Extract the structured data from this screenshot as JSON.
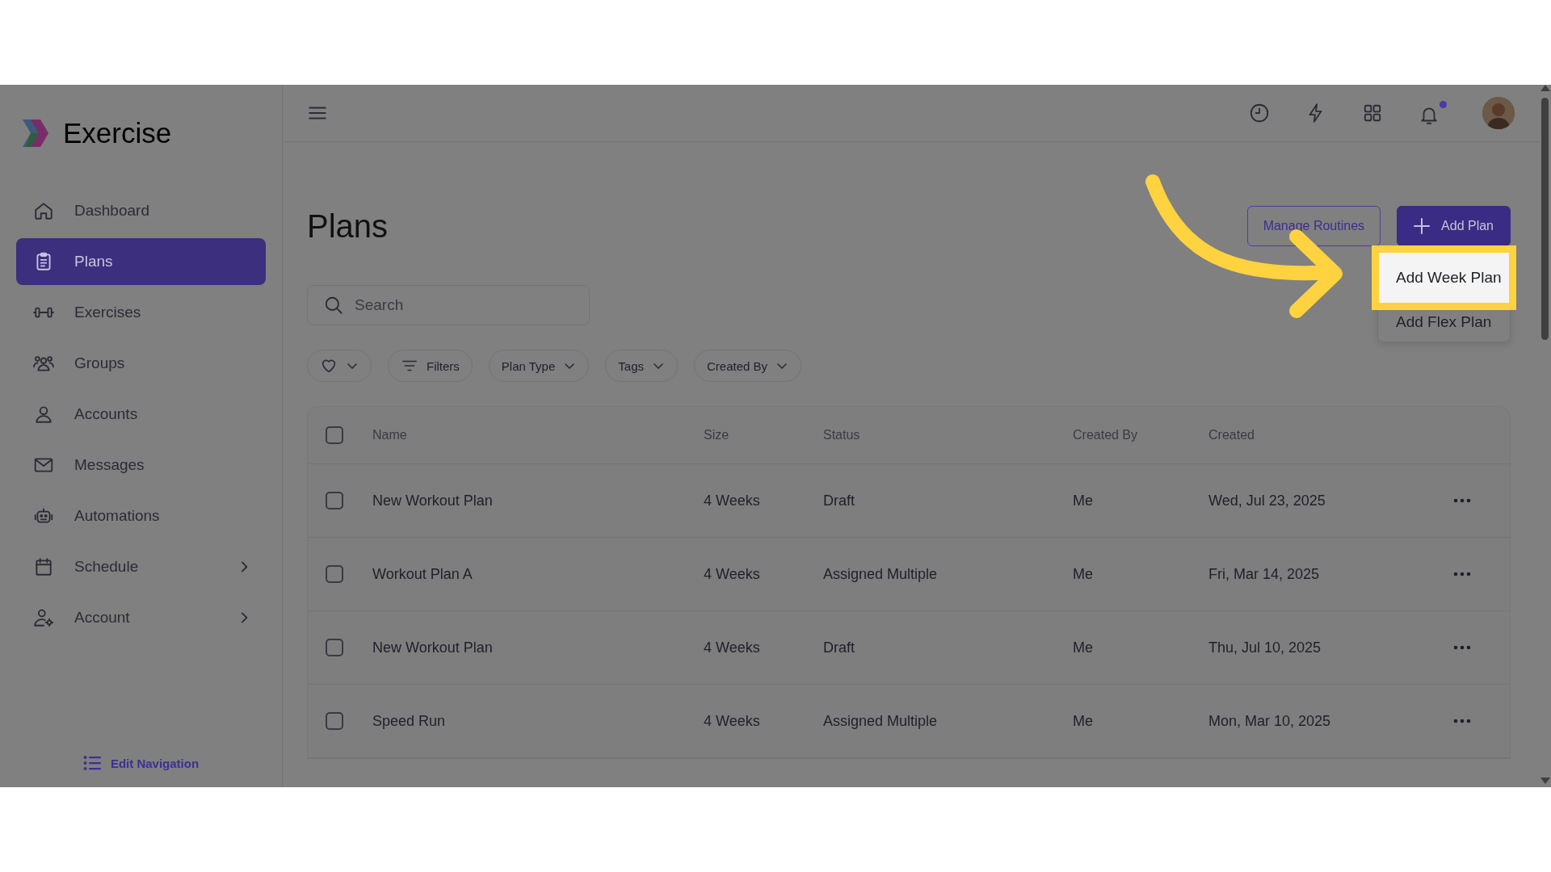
{
  "app": {
    "name": "Exercise"
  },
  "sidebar": {
    "items": [
      {
        "label": "Dashboard",
        "selected": false,
        "has_submenu": false
      },
      {
        "label": "Plans",
        "selected": true,
        "has_submenu": false
      },
      {
        "label": "Exercises",
        "selected": false,
        "has_submenu": false
      },
      {
        "label": "Groups",
        "selected": false,
        "has_submenu": false
      },
      {
        "label": "Accounts",
        "selected": false,
        "has_submenu": false
      },
      {
        "label": "Messages",
        "selected": false,
        "has_submenu": false
      },
      {
        "label": "Automations",
        "selected": false,
        "has_submenu": false
      },
      {
        "label": "Schedule",
        "selected": false,
        "has_submenu": true
      },
      {
        "label": "Account",
        "selected": false,
        "has_submenu": true
      }
    ],
    "edit_navigation": "Edit Navigation"
  },
  "page": {
    "title": "Plans",
    "buttons": [
      {
        "kind": "outline",
        "label": "Manage Routines"
      },
      {
        "kind": "primary",
        "label": "Add Plan"
      }
    ],
    "add_menu": [
      {
        "label": "Add Week Plan",
        "highlighted": true
      },
      {
        "label": "Add Flex Plan",
        "highlighted": false
      }
    ],
    "search": {
      "placeholder": "Search"
    },
    "filters": [
      {
        "kind": "favorite"
      },
      {
        "kind": "filter",
        "label": "Filters"
      },
      {
        "kind": "dropdown",
        "label": "Plan Type"
      },
      {
        "kind": "dropdown",
        "label": "Tags"
      },
      {
        "kind": "dropdown",
        "label": "Created By"
      }
    ]
  },
  "table": {
    "columns": [
      "Name",
      "Size",
      "Status",
      "Created By",
      "Created"
    ],
    "select_all": {
      "checked": false
    },
    "rows": [
      {
        "checked": false,
        "cells": [
          "New Workout Plan",
          "4 Weeks",
          "Draft",
          "Me",
          "Wed, Jul 23, 2025"
        ]
      },
      {
        "checked": false,
        "cells": [
          "Workout Plan A",
          "4 Weeks",
          "Assigned Multiple",
          "Me",
          "Fri, Mar 14, 2025"
        ]
      },
      {
        "checked": false,
        "cells": [
          "New Workout Plan",
          "4 Weeks",
          "Draft",
          "Me",
          "Thu, Jul 10, 2025"
        ]
      },
      {
        "checked": false,
        "cells": [
          "Speed Run",
          "4 Weeks",
          "Assigned Multiple",
          "Me",
          "Mon, Mar 10, 2025"
        ]
      }
    ]
  }
}
